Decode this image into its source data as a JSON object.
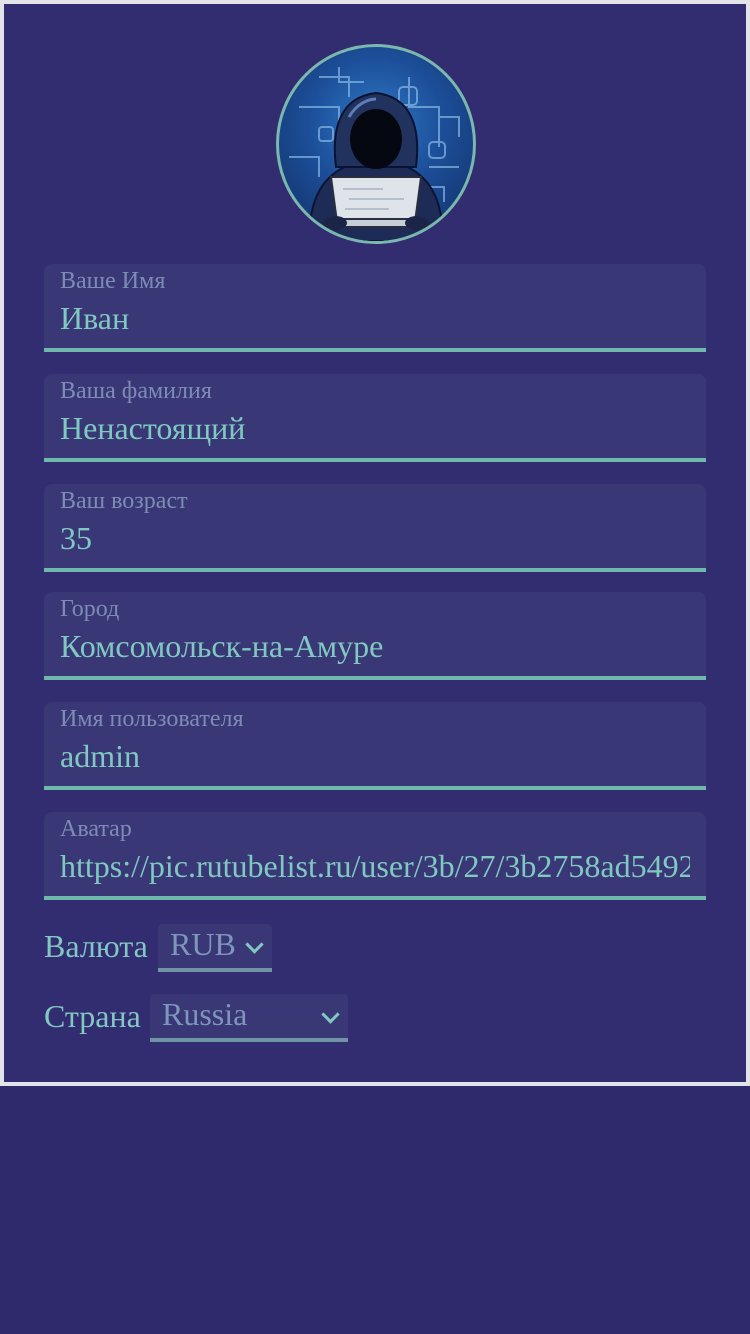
{
  "profile": {
    "avatar_icon": "hooded-hacker-avatar-icon",
    "fields": [
      {
        "label": "Ваше Имя",
        "value": "Иван"
      },
      {
        "label": "Ваша фамилия",
        "value": "Ненастоящий"
      },
      {
        "label": "Ваш возраст",
        "value": "35"
      },
      {
        "label": "Город",
        "value": "Комсомольск-на-Амуре"
      },
      {
        "label": "Имя пользователя",
        "value": "admin"
      },
      {
        "label": "Аватар",
        "value": "https://pic.rutubelist.ru/user/3b/27/3b2758ad5492"
      }
    ],
    "currency": {
      "label": "Валюта",
      "value": "RUB"
    },
    "country": {
      "label": "Страна",
      "value": "Russia"
    }
  },
  "colors": {
    "background": "#2e2a6b",
    "card": "#312d70",
    "field_bg": "#3a3777",
    "accent": "#6fb8ad",
    "label_text": "#7d8cb4",
    "value_text": "#7fc9c0"
  }
}
